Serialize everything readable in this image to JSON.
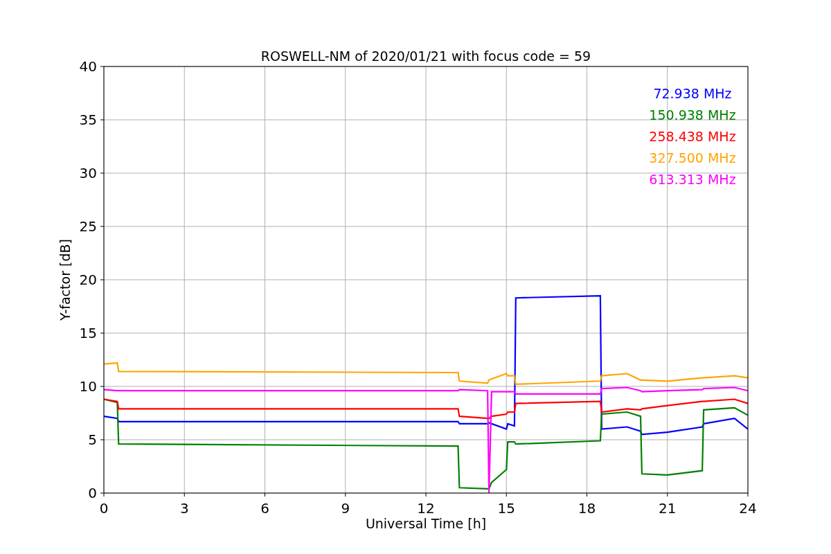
{
  "figure": {
    "chart_data": {
      "type": "line",
      "title": "ROSWELL-NM of 2020/01/21 with focus code = 59",
      "xlabel": "Universal Time [h]",
      "ylabel": "Y-factor [dB]",
      "x": [
        0,
        0.5,
        0.55,
        13.2,
        13.25,
        14.3,
        14.35,
        14.45,
        15.0,
        15.05,
        15.3,
        15.35,
        18.5,
        18.55,
        19.5,
        20.0,
        20.05,
        21.0,
        22.3,
        22.35,
        23.5,
        24
      ],
      "series": [
        {
          "name": "72.938 MHz",
          "color": "#0000ff",
          "values": [
            7.2,
            7.0,
            6.7,
            6.7,
            6.5,
            6.5,
            6.6,
            6.5,
            6.0,
            6.5,
            6.3,
            18.3,
            18.5,
            6.0,
            6.2,
            5.8,
            5.5,
            5.7,
            6.2,
            6.5,
            7.0,
            6.0
          ]
        },
        {
          "name": "150.938 MHz",
          "color": "#008000",
          "values": [
            8.8,
            8.5,
            4.6,
            4.4,
            0.5,
            0.4,
            0.4,
            1.0,
            2.2,
            4.8,
            4.8,
            4.6,
            4.9,
            7.4,
            7.6,
            7.2,
            1.8,
            1.7,
            2.1,
            7.8,
            8.0,
            7.3
          ]
        },
        {
          "name": "258.438 MHz",
          "color": "#ff0000",
          "values": [
            8.8,
            8.6,
            7.9,
            7.9,
            7.2,
            7.0,
            7.0,
            7.2,
            7.4,
            7.6,
            7.6,
            8.4,
            8.6,
            7.6,
            7.9,
            7.8,
            7.9,
            8.2,
            8.6,
            8.6,
            8.8,
            8.4
          ]
        },
        {
          "name": "327.500 MHz",
          "color": "#ffa500",
          "values": [
            12.1,
            12.2,
            11.4,
            11.3,
            10.5,
            10.3,
            10.6,
            10.7,
            11.2,
            11.0,
            11.0,
            10.2,
            10.5,
            11.0,
            11.2,
            10.6,
            10.6,
            10.5,
            10.8,
            10.8,
            11.0,
            10.8
          ]
        },
        {
          "name": "613.313 MHz",
          "color": "#ff00ff",
          "values": [
            9.7,
            9.6,
            9.6,
            9.6,
            9.7,
            9.6,
            0,
            9.5,
            9.5,
            9.5,
            9.5,
            9.3,
            9.3,
            9.8,
            9.9,
            9.6,
            9.5,
            9.6,
            9.7,
            9.8,
            9.9,
            9.6
          ]
        }
      ],
      "xlim": [
        0,
        24
      ],
      "ylim": [
        0,
        40
      ],
      "xticks": [
        0,
        3,
        6,
        9,
        12,
        15,
        18,
        21,
        24
      ],
      "yticks": [
        0,
        5,
        10,
        15,
        20,
        25,
        30,
        35,
        40
      ],
      "grid": true
    }
  }
}
